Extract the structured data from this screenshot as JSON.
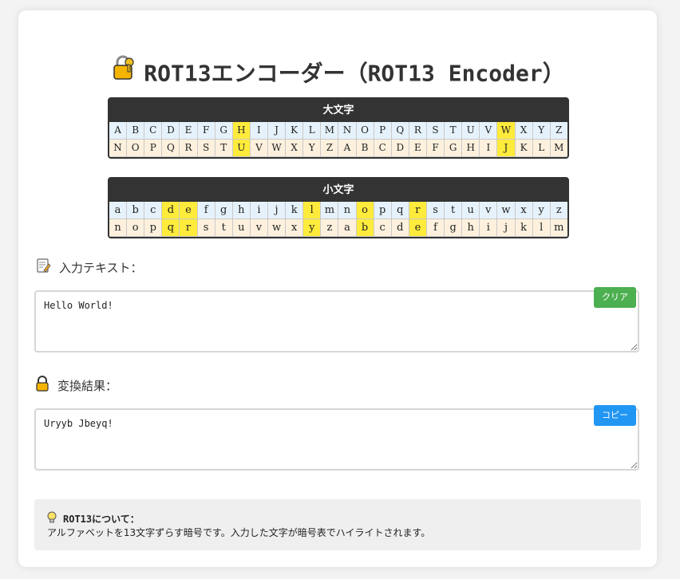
{
  "title": "ROT13エンコーダー（ROT13 Encoder）",
  "upper": {
    "heading": "大文字",
    "plain": [
      "A",
      "B",
      "C",
      "D",
      "E",
      "F",
      "G",
      "H",
      "I",
      "J",
      "K",
      "L",
      "M",
      "N",
      "O",
      "P",
      "Q",
      "R",
      "S",
      "T",
      "U",
      "V",
      "W",
      "X",
      "Y",
      "Z"
    ],
    "cipher": [
      "N",
      "O",
      "P",
      "Q",
      "R",
      "S",
      "T",
      "U",
      "V",
      "W",
      "X",
      "Y",
      "Z",
      "A",
      "B",
      "C",
      "D",
      "E",
      "F",
      "G",
      "H",
      "I",
      "J",
      "K",
      "L",
      "M"
    ],
    "highlighted": [
      "H",
      "W"
    ]
  },
  "lower": {
    "heading": "小文字",
    "plain": [
      "a",
      "b",
      "c",
      "d",
      "e",
      "f",
      "g",
      "h",
      "i",
      "j",
      "k",
      "l",
      "m",
      "n",
      "o",
      "p",
      "q",
      "r",
      "s",
      "t",
      "u",
      "v",
      "w",
      "x",
      "y",
      "z"
    ],
    "cipher": [
      "n",
      "o",
      "p",
      "q",
      "r",
      "s",
      "t",
      "u",
      "v",
      "w",
      "x",
      "y",
      "z",
      "a",
      "b",
      "c",
      "d",
      "e",
      "f",
      "g",
      "h",
      "i",
      "j",
      "k",
      "l",
      "m"
    ],
    "highlighted": [
      "d",
      "e",
      "l",
      "o",
      "r"
    ]
  },
  "input": {
    "label": "入力テキスト：",
    "value": "Hello World!",
    "clear_button": "クリア"
  },
  "output": {
    "label": "変換結果：",
    "value": "Uryyb Jbeyq!",
    "copy_button": "コピー"
  },
  "info": {
    "title": "ROT13について：",
    "body": "アルファベットを13文字ずらす暗号です。入力した文字が暗号表でハイライトされます。"
  },
  "colors": {
    "highlight": "#ffeb3b",
    "plain_row": "#e6f2fb",
    "cipher_row": "#fdf1de",
    "clear_button": "#4caf50",
    "copy_button": "#2196f3"
  },
  "icons": {
    "title": "lock-with-key-icon",
    "input": "memo-icon",
    "output": "lock-icon",
    "info": "lightbulb-icon"
  }
}
